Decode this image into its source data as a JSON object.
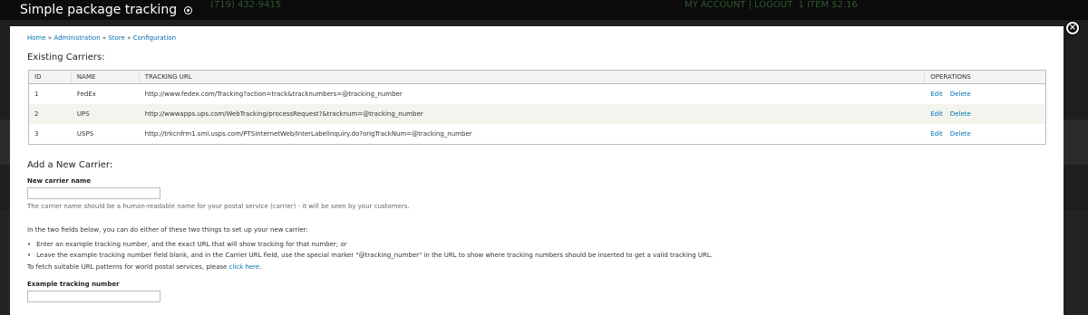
{
  "background": {
    "phone": "(719) 432-9415",
    "account": "MY ACCOUNT | LOGOUT",
    "cart": "1 ITEM  $2.16"
  },
  "modal": {
    "title": "Simple package tracking",
    "close_label": "×"
  },
  "breadcrumb": {
    "items": [
      "Home",
      "Administration",
      "Store",
      "Configuration"
    ],
    "separator": " » "
  },
  "carriers": {
    "heading": "Existing Carriers:",
    "columns": [
      "ID",
      "NAME",
      "TRACKING URL",
      "OPERATIONS"
    ],
    "rows": [
      {
        "id": "1",
        "name": "FedEx",
        "url": "http://www.fedex.com/Tracking?action=track&tracknumbers=@tracking_number",
        "edit": "Edit",
        "delete": "Delete"
      },
      {
        "id": "2",
        "name": "UPS",
        "url": "http://wwwapps.ups.com/WebTracking/processRequest?&tracknum=@tracking_number",
        "edit": "Edit",
        "delete": "Delete"
      },
      {
        "id": "3",
        "name": "USPS",
        "url": "http://trkcnfrm1.smi.usps.com/PTSInternetWeb/InterLabelInquiry.do?origTrackNum=@tracking_number",
        "edit": "Edit",
        "delete": "Delete"
      }
    ]
  },
  "add": {
    "heading": "Add a New Carrier:",
    "carrier_label": "New carrier name",
    "carrier_value": "",
    "carrier_desc": "The carrier name should be a human-readable name for your postal service (carrier) - it will be seen by your customers.",
    "intro": "In the two fields below, you can do either of these two things to set up your new carrier:",
    "bullets": [
      "Enter an example tracking number, and the exact URL that will show tracking for that number; or",
      "Leave the example tracking number field blank, and in the Carrier URL field, use the special marker \"@tracking_number\" in the URL to show where tracking numbers should be inserted to get a valid tracking URL."
    ],
    "fetch_text": "To fetch suitable URL patterns for world postal services, please ",
    "fetch_link": "click here",
    "fetch_end": ".",
    "example_label": "Example tracking number",
    "example_value": ""
  },
  "colors": {
    "link": "#0071b3",
    "header_bg": "#0b0b0b",
    "row_alt": "#f3f4ee"
  }
}
